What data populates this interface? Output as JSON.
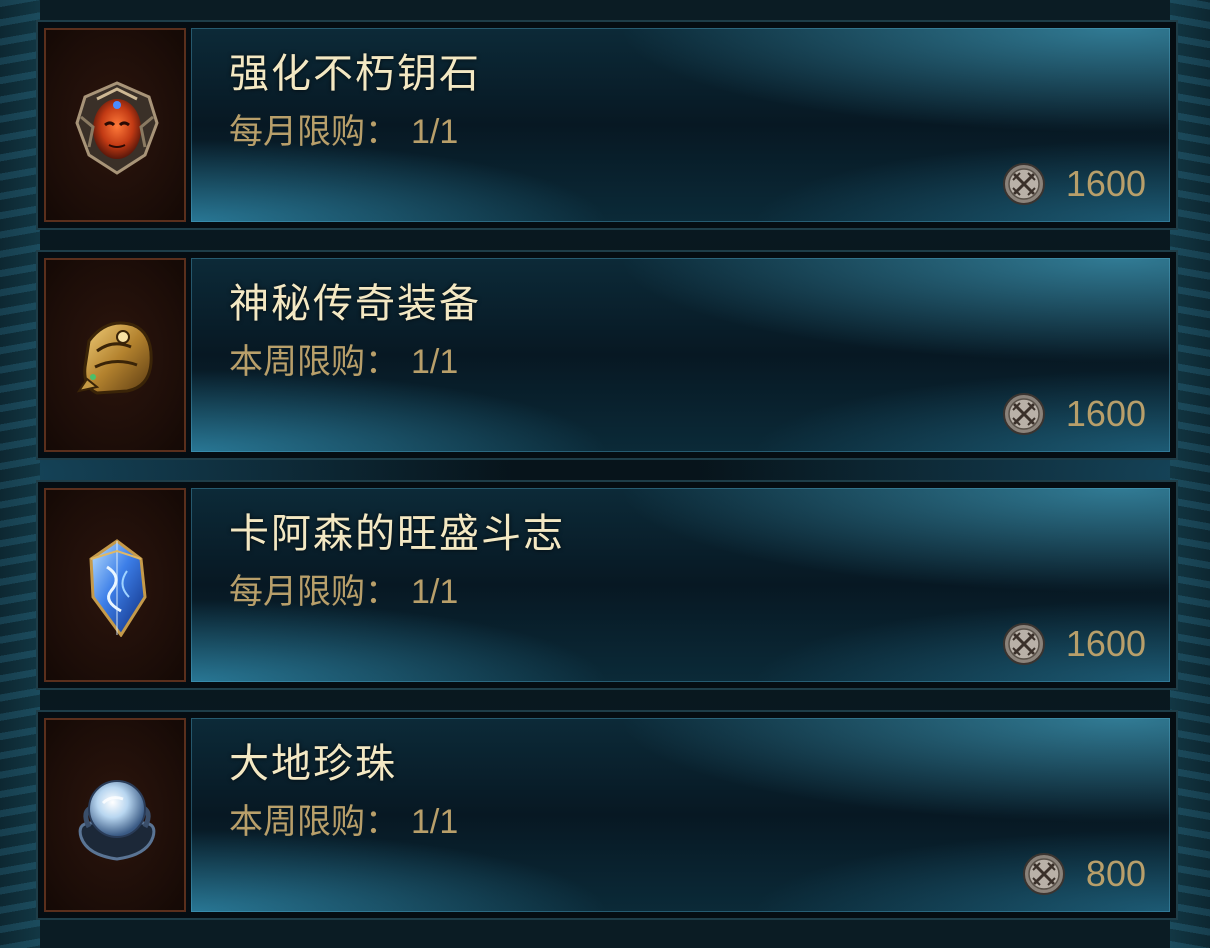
{
  "items": [
    {
      "icon": "demon-helm-icon",
      "name": "强化不朽钥石",
      "limit_label": "每月限购：",
      "limit_value": "1/1",
      "currency_icon": "crossed-swords-coin-icon",
      "price": "1600"
    },
    {
      "icon": "golden-pauldron-icon",
      "name": "神秘传奇装备",
      "limit_label": "本周限购：",
      "limit_value": "1/1",
      "currency_icon": "crossed-swords-coin-icon",
      "price": "1600"
    },
    {
      "icon": "blue-crystal-icon",
      "name": "卡阿森的旺盛斗志",
      "limit_label": "每月限购：",
      "limit_value": "1/1",
      "currency_icon": "crossed-swords-coin-icon",
      "price": "1600"
    },
    {
      "icon": "earth-pearl-icon",
      "name": "大地珍珠",
      "limit_label": "本周限购：",
      "limit_value": "1/1",
      "currency_icon": "crossed-swords-coin-icon",
      "price": "800"
    }
  ],
  "colors": {
    "name_text": "#f3e8c3",
    "limit_text": "#b89f6a",
    "panel_glow": "#50bee1",
    "icon_slot_border": "#5a2f1c"
  }
}
